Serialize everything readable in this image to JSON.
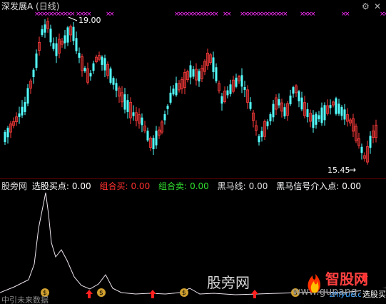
{
  "header": {
    "stock_name": "深发展A",
    "period": "(日线)"
  },
  "window_controls": {
    "settings": "⚙",
    "close": "✕"
  },
  "main_chart": {
    "high_label": "19.00",
    "low_label": "15.45",
    "low_arrow": "→",
    "signal_marks": "×××",
    "colors": {
      "up": "#ff3b3b",
      "down": "#54ffff",
      "signal": "#ff30ff",
      "arrow": "#ffffff"
    }
  },
  "indicator": {
    "name": "股旁网",
    "items": [
      {
        "label": "选股买点:",
        "value": "0.00",
        "color": "#ffffff"
      },
      {
        "label": "组合买:",
        "value": "0.00",
        "color": "#ff3030"
      },
      {
        "label": "组合卖:",
        "value": "0.00",
        "color": "#30e030"
      },
      {
        "label": "黑马线:",
        "value": "0.00",
        "color": "#e0e0e0"
      },
      {
        "label": "黑马信号介入点:",
        "value": "0.00",
        "color": "#ffffff"
      }
    ],
    "bottom_left_text": "中引未来数据",
    "coin_char": "$",
    "colors": {
      "line": "#f0e6f0",
      "arrow": "#ff2020",
      "coin": "#d0a030"
    }
  },
  "watermarks": {
    "center": "股旁网",
    "url": "www.gupang.com",
    "right_logo_1": "智股网",
    "right_logo_2": "zhiyue.com",
    "corner": "选股买"
  }
}
